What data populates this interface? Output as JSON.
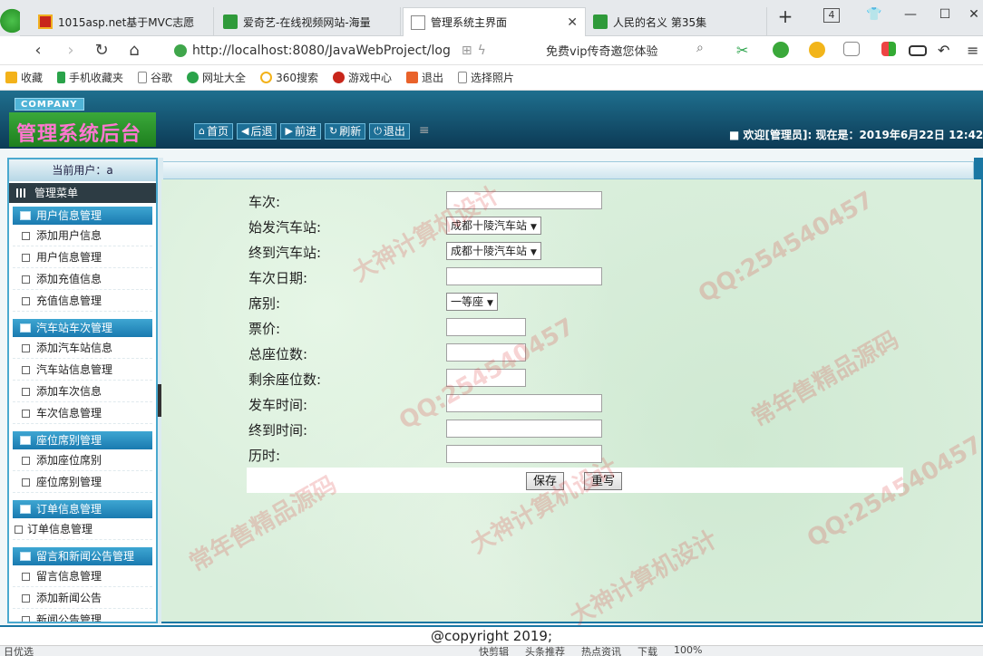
{
  "browser": {
    "tabs": [
      {
        "title": "1015asp.net基于MVC志愿",
        "icon": "red"
      },
      {
        "title": "爱奇艺-在线视频网站-海量",
        "icon": "green"
      },
      {
        "title": "管理系统主界面",
        "icon": "page",
        "active": true
      },
      {
        "title": "人民的名义 第35集",
        "icon": "green"
      }
    ],
    "new_tab": "+",
    "tab_count": "4",
    "url": "http://localhost:8080/JavaWebProject/log",
    "promo_text": "免费vip传奇邀您体验",
    "bookmarks": [
      "收藏",
      "手机收藏夹",
      "谷歌",
      "网址大全",
      "360搜索",
      "游戏中心",
      "退出",
      "选择照片"
    ]
  },
  "app": {
    "company": "COMPANY",
    "title": "管理系统后台",
    "nav": [
      "首页",
      "后退",
      "前进",
      "刷新",
      "退出"
    ],
    "welcome": "■ 欢迎[管理员]:  现在是：2019年6月22日 12:42:01",
    "current_user": "当前用户：a",
    "menu_title": "管理菜单",
    "menu_groups": [
      {
        "title": "用户信息管理",
        "items": [
          "添加用户信息",
          "用户信息管理",
          "添加充值信息",
          "充值信息管理"
        ]
      },
      {
        "title": "汽车站车次管理",
        "items": [
          "添加汽车站信息",
          "汽车站信息管理",
          "添加车次信息",
          "车次信息管理"
        ]
      },
      {
        "title": "座位席别管理",
        "items": [
          "添加座位席别",
          "座位席别管理"
        ]
      },
      {
        "title": "订单信息管理",
        "items": [
          "订单信息管理"
        ]
      },
      {
        "title": "留言和新闻公告管理",
        "items": [
          "留言信息管理",
          "添加新闻公告",
          "新闻公告管理"
        ]
      }
    ],
    "form": {
      "trip_no": {
        "label": "车次:",
        "value": ""
      },
      "start_station": {
        "label": "始发汽车站:",
        "value": "成都十陵汽车站"
      },
      "end_station": {
        "label": "终到汽车站:",
        "value": "成都十陵汽车站"
      },
      "trip_date": {
        "label": "车次日期:",
        "value": ""
      },
      "seat_class": {
        "label": "席别:",
        "value": "一等座"
      },
      "price": {
        "label": "票价:",
        "value": ""
      },
      "total_seats": {
        "label": "总座位数:",
        "value": ""
      },
      "remaining_seats": {
        "label": "剩余座位数:",
        "value": ""
      },
      "depart_time": {
        "label": "发车时间:",
        "value": ""
      },
      "arrive_time": {
        "label": "终到时间:",
        "value": ""
      },
      "duration": {
        "label": "历时:",
        "value": ""
      },
      "save_label": "保存",
      "reset_label": "重写"
    },
    "footer": "@copyright 2019;"
  },
  "status": {
    "left": "日优选",
    "right": [
      "快剪辑",
      "头条推荐",
      "热点资讯",
      "下载",
      "100%"
    ]
  },
  "watermarks": [
    "QQ:254540457",
    "常年售精品源码",
    "大神计算机设计"
  ]
}
